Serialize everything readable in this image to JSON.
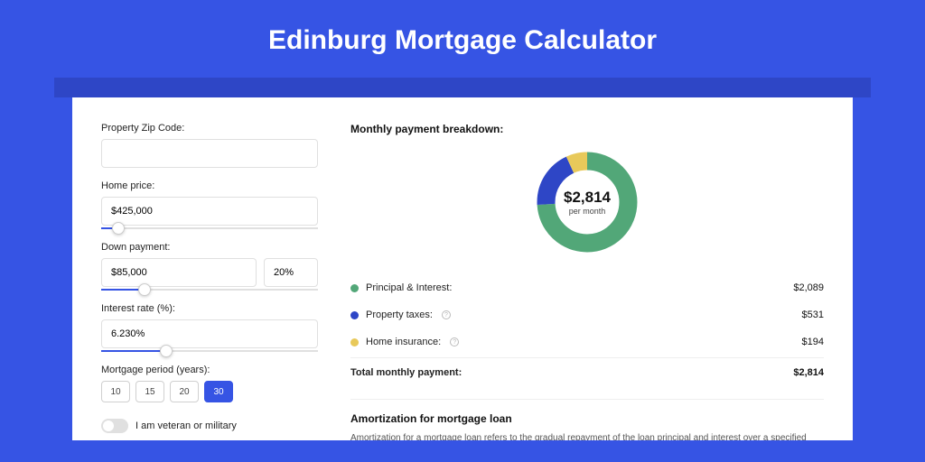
{
  "header": {
    "title": "Edinburg Mortgage Calculator"
  },
  "form": {
    "zip": {
      "label": "Property Zip Code:",
      "value": ""
    },
    "homePrice": {
      "label": "Home price:",
      "value": "$425,000",
      "sliderPct": 8
    },
    "downPayment": {
      "label": "Down payment:",
      "amount": "$85,000",
      "percent": "20%",
      "sliderPct": 20
    },
    "interestRate": {
      "label": "Interest rate (%):",
      "value": "6.230%",
      "sliderPct": 30
    },
    "period": {
      "label": "Mortgage period (years):",
      "options": [
        "10",
        "15",
        "20",
        "30"
      ],
      "active": "30"
    },
    "veteran": {
      "label": "I am veteran or military"
    }
  },
  "breakdown": {
    "title": "Monthly payment breakdown:",
    "centerAmount": "$2,814",
    "centerSub": "per month",
    "items": [
      {
        "color": "green",
        "label": "Principal & Interest:",
        "value": "$2,089",
        "pct": 74,
        "help": false
      },
      {
        "color": "blue",
        "label": "Property taxes:",
        "value": "$531",
        "pct": 19,
        "help": true
      },
      {
        "color": "yellow",
        "label": "Home insurance:",
        "value": "$194",
        "pct": 7,
        "help": true
      }
    ],
    "totalLabel": "Total monthly payment:",
    "totalValue": "$2,814"
  },
  "amortization": {
    "title": "Amortization for mortgage loan",
    "text": "Amortization for a mortgage loan refers to the gradual repayment of the loan principal and interest over a specified"
  },
  "chart_data": {
    "type": "pie",
    "title": "Monthly payment breakdown",
    "series": [
      {
        "name": "Principal & Interest",
        "value": 2089,
        "color": "#52a778"
      },
      {
        "name": "Property taxes",
        "value": 531,
        "color": "#2e46c6"
      },
      {
        "name": "Home insurance",
        "value": 194,
        "color": "#e8c95a"
      }
    ],
    "total": 2814,
    "centerLabel": "$2,814 per month"
  }
}
